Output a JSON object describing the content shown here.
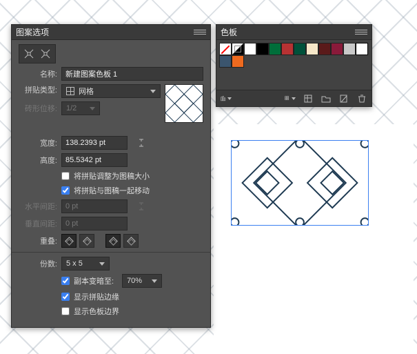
{
  "patternOptions": {
    "title": "图案选项",
    "nameLabel": "名称:",
    "nameValue": "新建图案色板 1",
    "tileTypeLabel": "拼贴类型:",
    "tileTypeValue": "网格",
    "brickOffsetLabel": "砖形位移:",
    "brickOffsetValue": "1/2",
    "widthLabel": "宽度:",
    "widthValue": "138.2393 pt",
    "heightLabel": "高度:",
    "heightValue": "85.5342 pt",
    "fitCheckbox": "将拼贴调整为图稿大小",
    "moveCheckbox": "将拼贴与图稿一起移动",
    "hSpacingLabel": "水平间距:",
    "hSpacingValue": "0 pt",
    "vSpacingLabel": "垂直间距:",
    "vSpacingValue": "0 pt",
    "overlapLabel": "重叠:",
    "copiesLabel": "份数:",
    "copiesValue": "5 x 5",
    "dimLabel": "副本变暗至:",
    "dimValue": "70%",
    "showTileEdge": "显示拼贴边缘",
    "showSwatchBounds": "显示色板边界"
  },
  "swatches": {
    "title": "色板",
    "colors": [
      "#ffffff",
      "#000000",
      "#006e3a",
      "#b73233",
      "#00513a",
      "#f6e7c8",
      "#5a1a1a",
      "#8a1a3a",
      "#c9c9c9"
    ],
    "row2": [
      "#3b556e",
      "#ee6a1f"
    ]
  }
}
